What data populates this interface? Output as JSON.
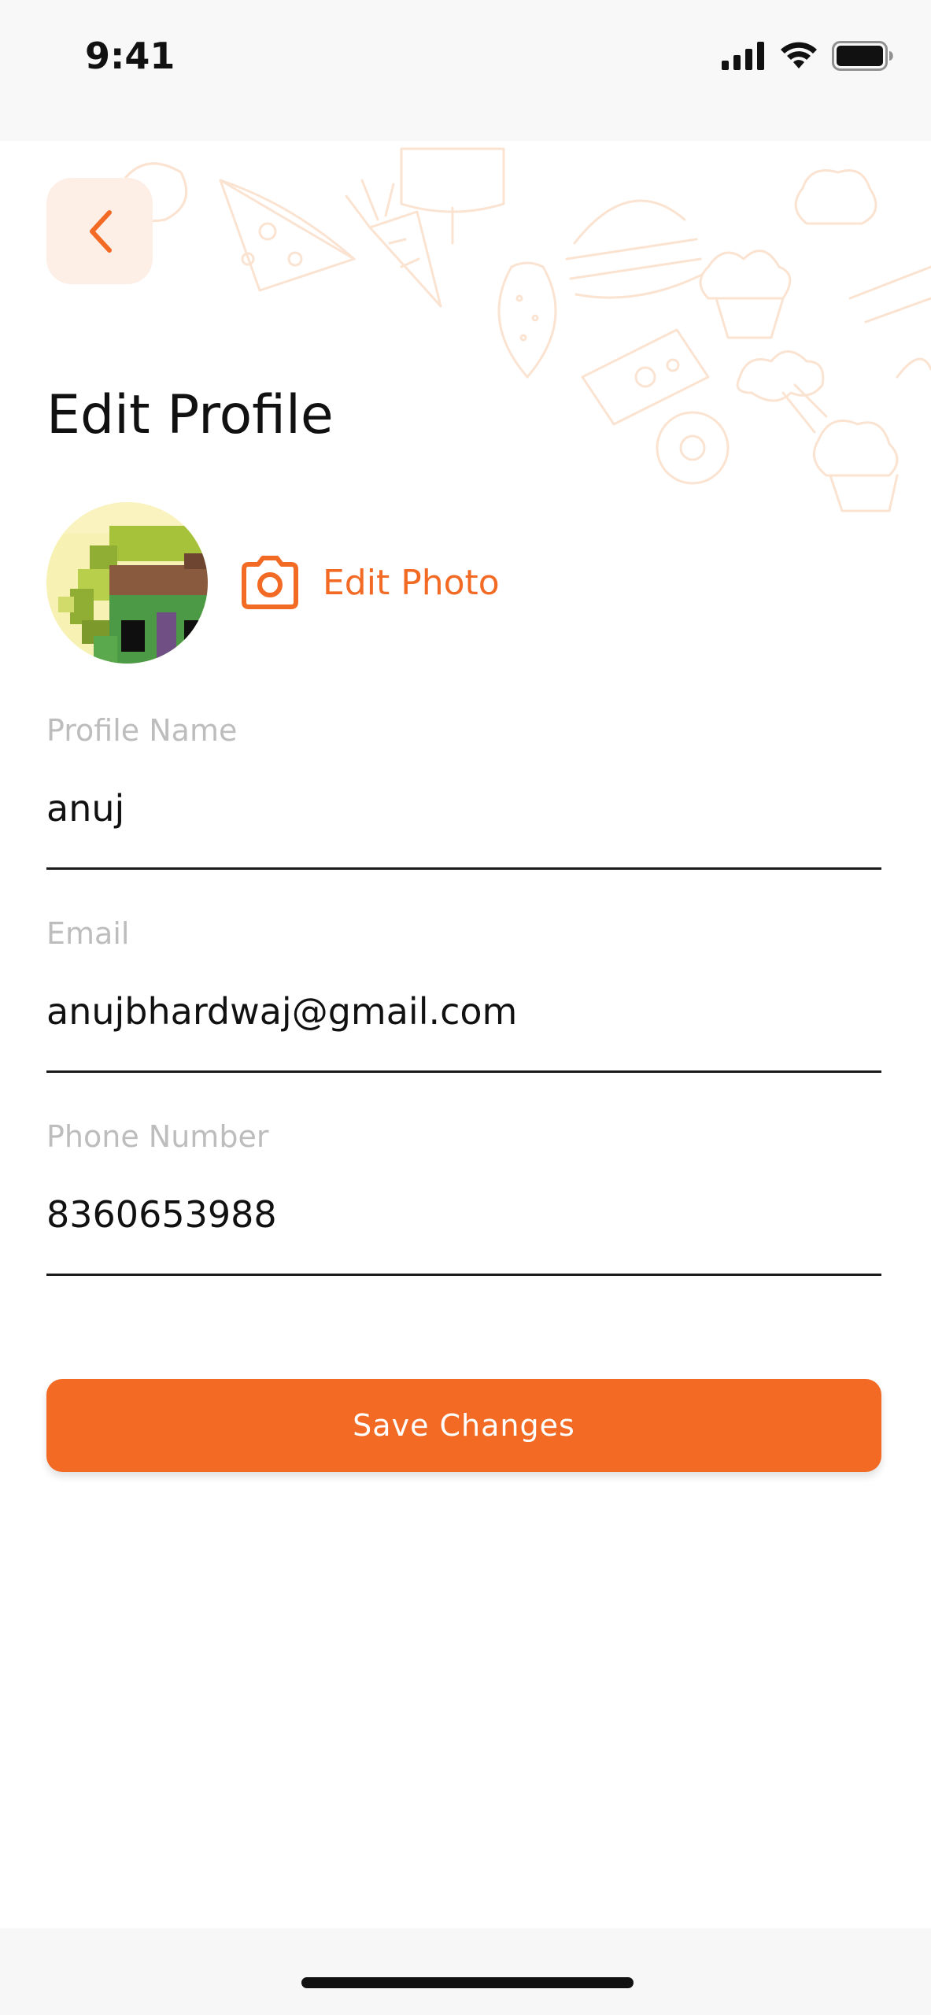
{
  "status_bar": {
    "time": "9:41"
  },
  "header": {
    "back_icon": "chevron-left-icon",
    "title": "Edit Profile"
  },
  "profile_photo": {
    "edit_icon": "camera-icon",
    "edit_label": "Edit Photo"
  },
  "form": {
    "profile_name": {
      "label": "Profile Name",
      "value": "anuj"
    },
    "email": {
      "label": "Email",
      "value": "anujbhardwaj@gmail.com"
    },
    "phone": {
      "label": "Phone Number",
      "value": "8360653988"
    }
  },
  "actions": {
    "save_label": "Save Changes"
  },
  "colors": {
    "accent": "#f26a24",
    "back_button_bg": "#fdeee6",
    "label": "#bdbdbd",
    "text": "#111111"
  }
}
